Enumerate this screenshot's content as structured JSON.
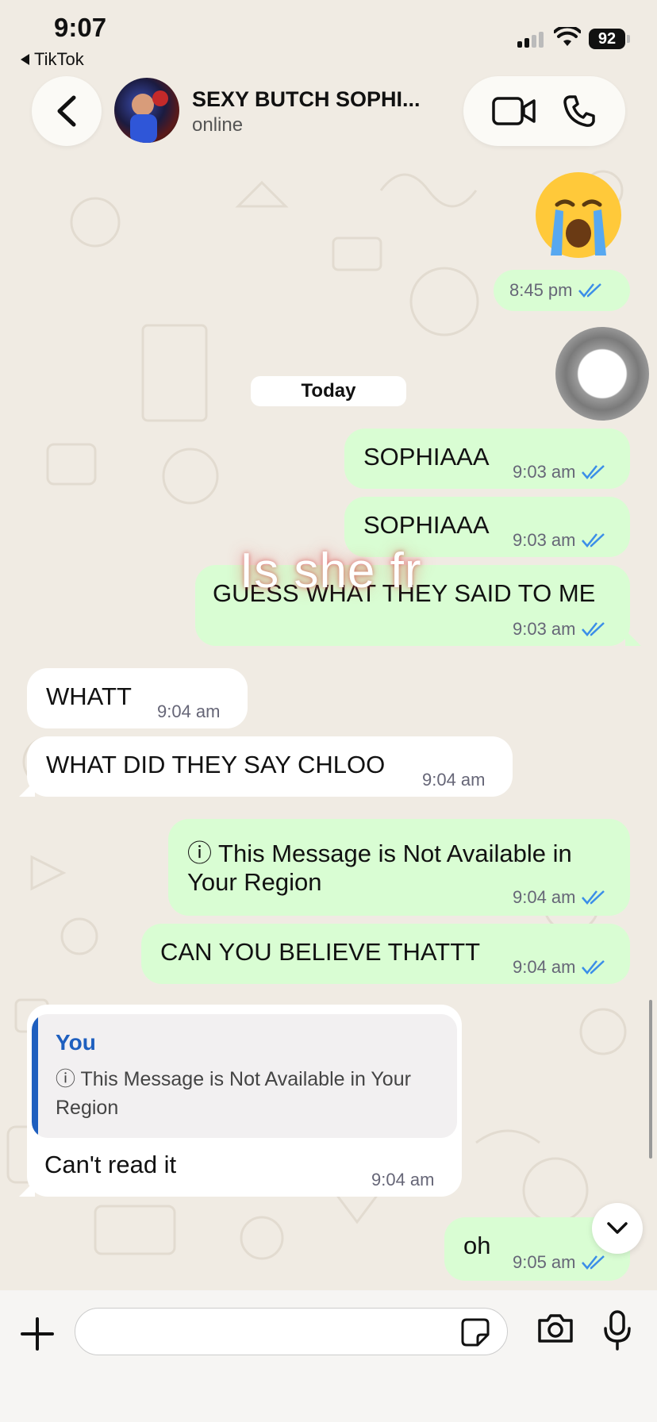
{
  "status_bar": {
    "time": "9:07",
    "back_app": "TikTok",
    "battery": "92"
  },
  "header": {
    "contact_name": "SEXY BUTCH SOPHI...",
    "contact_status": "online"
  },
  "date_divider": "Today",
  "overlay_caption": "Is she fr",
  "messages": [
    {
      "dir": "out",
      "text": "8:45 pm",
      "time": "8:45 pm",
      "emoji": "crying-face"
    },
    {
      "dir": "out",
      "text": "SOPHIAAA",
      "time": "9:03 am"
    },
    {
      "dir": "out",
      "text": "SOPHIAAA",
      "time": "9:03 am"
    },
    {
      "dir": "out",
      "text": "GUESS WHAT THEY SAID TO ME",
      "time": "9:03 am"
    },
    {
      "dir": "in",
      "text": "WHATT",
      "time": "9:04 am"
    },
    {
      "dir": "in",
      "text": "WHAT DID THEY SAY CHLOO",
      "time": "9:04 am"
    },
    {
      "dir": "out",
      "text_line1": "ⓘ This Message is Not Available in",
      "text_line2": "Your Region",
      "time": "9:04 am"
    },
    {
      "dir": "out",
      "text": "CAN YOU BELIEVE THATTT",
      "time": "9:04 am"
    },
    {
      "dir": "in",
      "quote_author": "You",
      "quote_text": "ⓘ This Message is Not Available in Your Region",
      "text": "Can't read it",
      "time": "9:04 am"
    },
    {
      "dir": "out",
      "text": "oh",
      "time": "9:05 am"
    }
  ],
  "composer": {
    "placeholder": ""
  },
  "colors": {
    "outgoing": "#d9fdd3",
    "incoming": "#ffffff",
    "read_ticks": "#3b8ee8",
    "quote_accent": "#1e5fbf",
    "background": "#efeae2"
  },
  "icons": [
    "video-call-icon",
    "voice-call-icon",
    "back-chevron-icon",
    "plus-icon",
    "sticker-icon",
    "camera-icon",
    "mic-icon",
    "chevron-down-icon",
    "double-tick-icon",
    "info-icon"
  ]
}
